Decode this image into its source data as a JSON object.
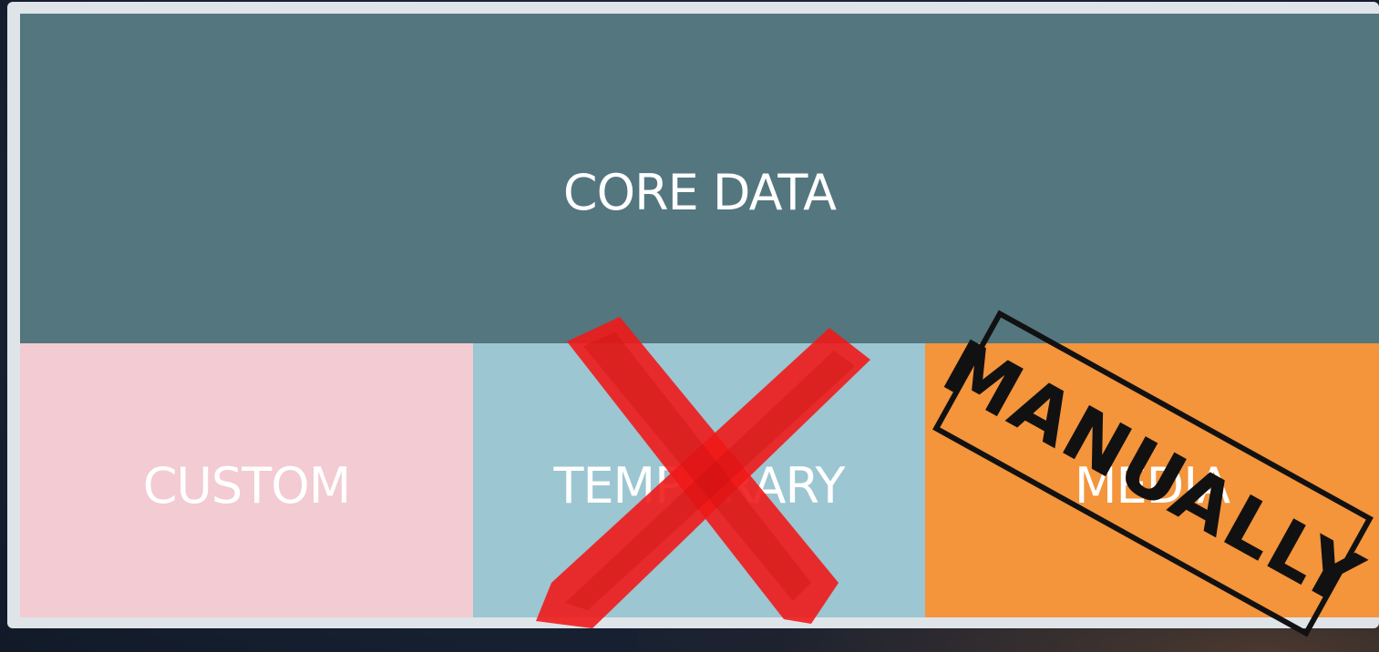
{
  "diagram": {
    "core_label": "CORE DATA",
    "custom_label": "CUSTOM",
    "temporary_label": "TEMPORARY",
    "media_label": "MEDIA"
  },
  "overlays": {
    "stamp_text": "MANUALLY",
    "cross_icon": "red-x-icon"
  },
  "colors": {
    "core": "#53767f",
    "custom": "#f3cbd2",
    "temporary": "#9cc6d1",
    "media": "#f4943b",
    "cross": "#f01a1a",
    "stamp": "#111111"
  }
}
